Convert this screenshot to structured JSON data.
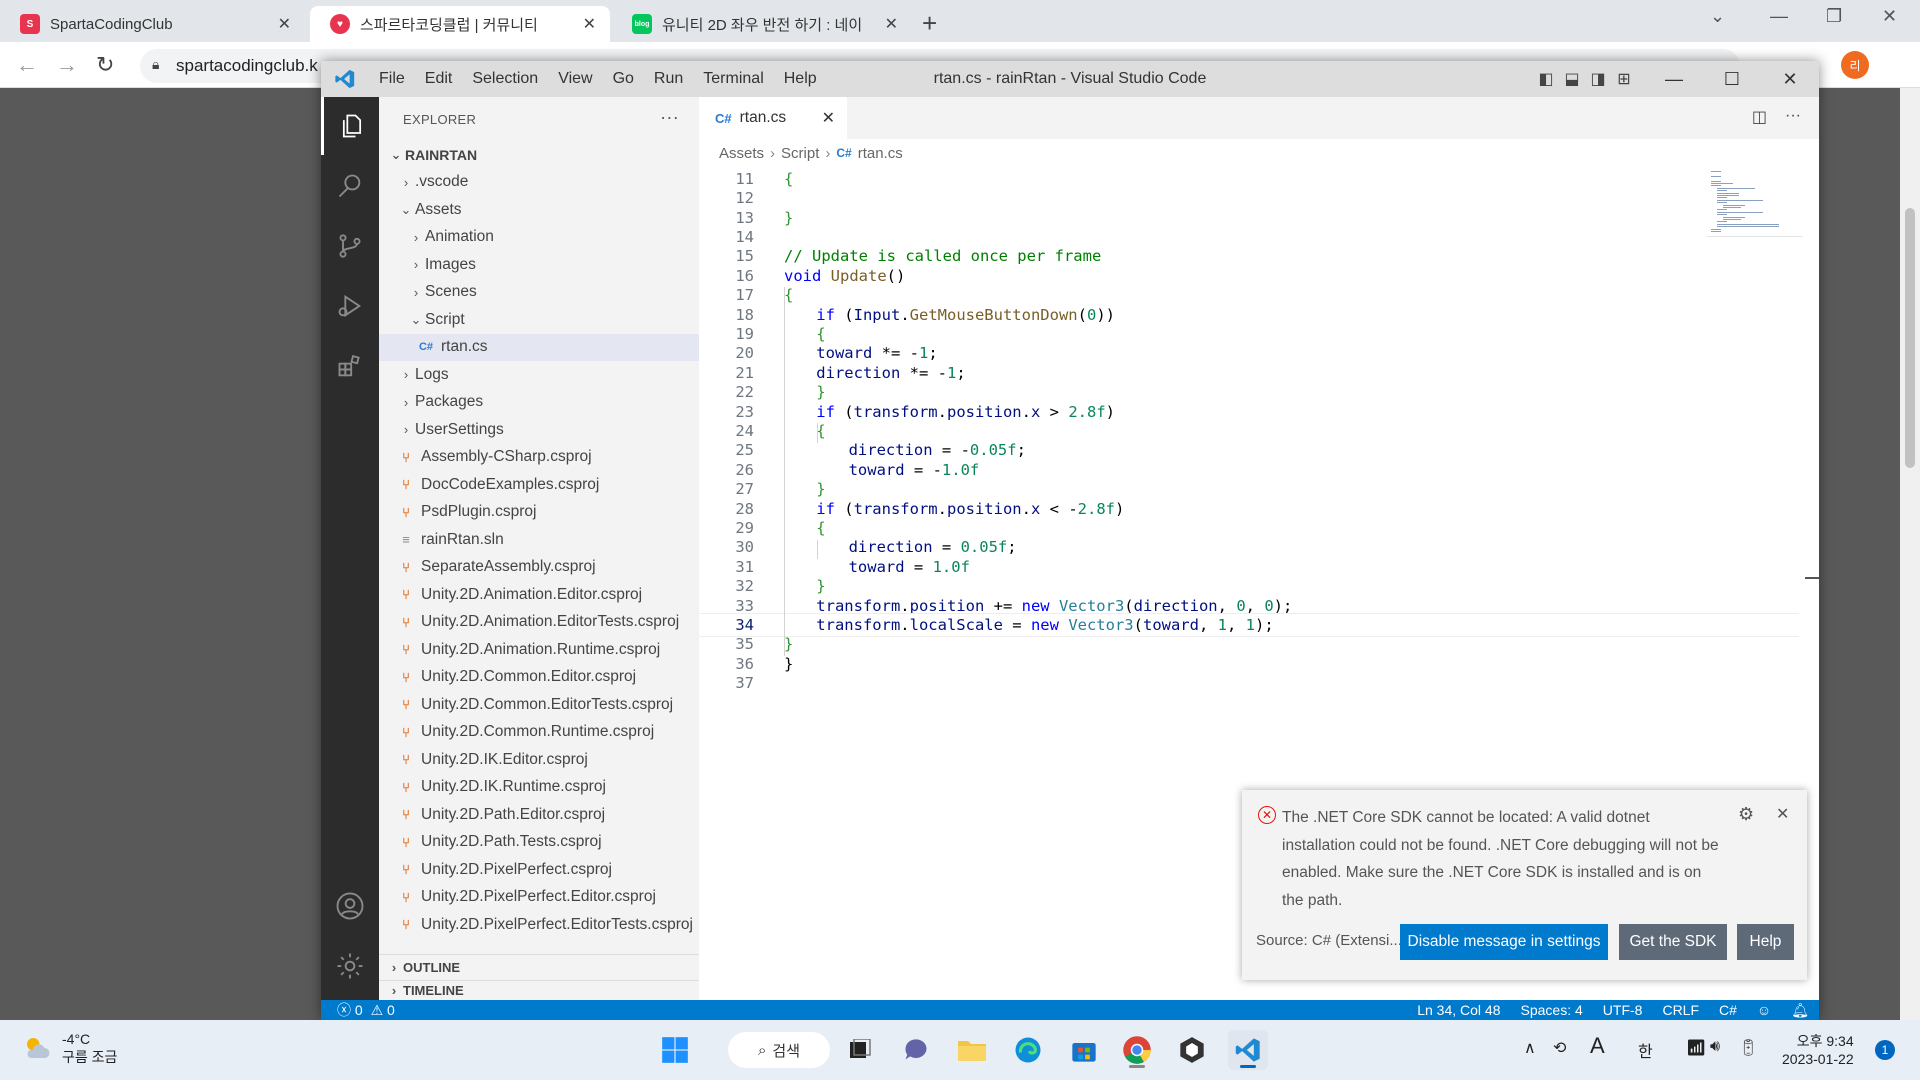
{
  "browser": {
    "tabs": [
      {
        "label": "SpartaCodingClub",
        "active": false
      },
      {
        "label": "스파르타코딩클럽 | 커뮤니티",
        "active": true
      },
      {
        "label": "유니티 2D 좌우 반전 하기 : 네이",
        "active": false
      }
    ],
    "url": "spartacodingclub.k",
    "profile_initial": "리"
  },
  "vscode": {
    "window_title": "rtan.cs - rainRtan - Visual Studio Code",
    "menu": [
      "File",
      "Edit",
      "Selection",
      "View",
      "Go",
      "Run",
      "Terminal",
      "Help"
    ],
    "explorer": {
      "header": "EXPLORER",
      "root": "RAINRTAN",
      "items": [
        {
          "label": ".vscode",
          "type": "folder",
          "depth": 1,
          "open": false
        },
        {
          "label": "Assets",
          "type": "folder",
          "depth": 1,
          "open": true
        },
        {
          "label": "Animation",
          "type": "folder",
          "depth": 2,
          "open": false
        },
        {
          "label": "Images",
          "type": "folder",
          "depth": 2,
          "open": false
        },
        {
          "label": "Scenes",
          "type": "folder",
          "depth": 2,
          "open": false
        },
        {
          "label": "Script",
          "type": "folder",
          "depth": 2,
          "open": true
        },
        {
          "label": "rtan.cs",
          "type": "cs",
          "depth": 3,
          "selected": true
        },
        {
          "label": "Logs",
          "type": "folder",
          "depth": 1,
          "open": false
        },
        {
          "label": "Packages",
          "type": "folder",
          "depth": 1,
          "open": false
        },
        {
          "label": "UserSettings",
          "type": "folder",
          "depth": 1,
          "open": false
        },
        {
          "label": "Assembly-CSharp.csproj",
          "type": "csproj",
          "depth": 1
        },
        {
          "label": "DocCodeExamples.csproj",
          "type": "csproj",
          "depth": 1
        },
        {
          "label": "PsdPlugin.csproj",
          "type": "csproj",
          "depth": 1
        },
        {
          "label": "rainRtan.sln",
          "type": "sln",
          "depth": 1
        },
        {
          "label": "SeparateAssembly.csproj",
          "type": "csproj",
          "depth": 1
        },
        {
          "label": "Unity.2D.Animation.Editor.csproj",
          "type": "csproj",
          "depth": 1
        },
        {
          "label": "Unity.2D.Animation.EditorTests.csproj",
          "type": "csproj",
          "depth": 1
        },
        {
          "label": "Unity.2D.Animation.Runtime.csproj",
          "type": "csproj",
          "depth": 1
        },
        {
          "label": "Unity.2D.Common.Editor.csproj",
          "type": "csproj",
          "depth": 1
        },
        {
          "label": "Unity.2D.Common.EditorTests.csproj",
          "type": "csproj",
          "depth": 1
        },
        {
          "label": "Unity.2D.Common.Runtime.csproj",
          "type": "csproj",
          "depth": 1
        },
        {
          "label": "Unity.2D.IK.Editor.csproj",
          "type": "csproj",
          "depth": 1
        },
        {
          "label": "Unity.2D.IK.Runtime.csproj",
          "type": "csproj",
          "depth": 1
        },
        {
          "label": "Unity.2D.Path.Editor.csproj",
          "type": "csproj",
          "depth": 1
        },
        {
          "label": "Unity.2D.Path.Tests.csproj",
          "type": "csproj",
          "depth": 1
        },
        {
          "label": "Unity.2D.PixelPerfect.csproj",
          "type": "csproj",
          "depth": 1
        },
        {
          "label": "Unity.2D.PixelPerfect.Editor.csproj",
          "type": "csproj",
          "depth": 1
        },
        {
          "label": "Unity.2D.PixelPerfect.EditorTests.csproj",
          "type": "csproj",
          "depth": 1
        }
      ],
      "outline": "OUTLINE",
      "timeline": "TIMELINE"
    },
    "editor_tab": "rtan.cs",
    "breadcrumb": [
      "Assets",
      "Script",
      "rtan.cs"
    ],
    "code_lines": [
      {
        "n": "11",
        "indent": 0,
        "t": [
          [
            "br",
            "{"
          ]
        ]
      },
      {
        "n": "12",
        "indent": 0,
        "t": []
      },
      {
        "n": "13",
        "indent": 0,
        "t": [
          [
            "br",
            "}"
          ]
        ]
      },
      {
        "n": "14",
        "indent": 0,
        "t": []
      },
      {
        "n": "15",
        "indent": 0,
        "t": [
          [
            "com",
            "// Update is called once per frame"
          ]
        ]
      },
      {
        "n": "16",
        "indent": 0,
        "t": [
          [
            "kw",
            "void"
          ],
          [
            "p",
            " "
          ],
          [
            "fn",
            "Update"
          ],
          [
            "p",
            "()"
          ]
        ]
      },
      {
        "n": "17",
        "indent": 0,
        "t": [
          [
            "br",
            "{"
          ]
        ]
      },
      {
        "n": "18",
        "indent": 1,
        "t": [
          [
            "kw",
            "if"
          ],
          [
            "p",
            " ("
          ],
          [
            "var",
            "Input"
          ],
          [
            "p",
            "."
          ],
          [
            "fn",
            "GetMouseButtonDown"
          ],
          [
            "p",
            "("
          ],
          [
            "num",
            "0"
          ],
          [
            "p",
            "))"
          ]
        ]
      },
      {
        "n": "19",
        "indent": 1,
        "t": [
          [
            "br",
            "{"
          ]
        ]
      },
      {
        "n": "20",
        "indent": 1,
        "t": [
          [
            "var",
            "toward"
          ],
          [
            "p",
            " *= -"
          ],
          [
            "num",
            "1"
          ],
          [
            "p",
            ";"
          ]
        ]
      },
      {
        "n": "21",
        "indent": 1,
        "t": [
          [
            "var",
            "direction"
          ],
          [
            "p",
            " *= -"
          ],
          [
            "num",
            "1"
          ],
          [
            "p",
            ";"
          ]
        ]
      },
      {
        "n": "22",
        "indent": 1,
        "t": [
          [
            "br",
            "}"
          ]
        ]
      },
      {
        "n": "23",
        "indent": 1,
        "t": [
          [
            "kw",
            "if"
          ],
          [
            "p",
            " ("
          ],
          [
            "var",
            "transform"
          ],
          [
            "p",
            "."
          ],
          [
            "var",
            "position"
          ],
          [
            "p",
            "."
          ],
          [
            "var",
            "x"
          ],
          [
            "p",
            " > "
          ],
          [
            "num",
            "2.8f"
          ],
          [
            "p",
            ")"
          ]
        ]
      },
      {
        "n": "24",
        "indent": 1,
        "t": [
          [
            "br",
            "{"
          ]
        ]
      },
      {
        "n": "25",
        "indent": 2,
        "t": [
          [
            "var",
            "direction"
          ],
          [
            "p",
            " = -"
          ],
          [
            "num",
            "0.05f"
          ],
          [
            "p",
            ";"
          ]
        ]
      },
      {
        "n": "26",
        "indent": 2,
        "t": [
          [
            "var",
            "toward"
          ],
          [
            "p",
            " = -"
          ],
          [
            "num",
            "1.0f"
          ]
        ]
      },
      {
        "n": "27",
        "indent": 1,
        "t": [
          [
            "br",
            "}"
          ]
        ]
      },
      {
        "n": "28",
        "indent": 1,
        "t": [
          [
            "kw",
            "if"
          ],
          [
            "p",
            " ("
          ],
          [
            "var",
            "transform"
          ],
          [
            "p",
            "."
          ],
          [
            "var",
            "position"
          ],
          [
            "p",
            "."
          ],
          [
            "var",
            "x"
          ],
          [
            "p",
            " < -"
          ],
          [
            "num",
            "2.8f"
          ],
          [
            "p",
            ")"
          ]
        ]
      },
      {
        "n": "29",
        "indent": 1,
        "t": [
          [
            "br",
            "{"
          ]
        ]
      },
      {
        "n": "30",
        "indent": 2,
        "t": [
          [
            "var",
            "direction"
          ],
          [
            "p",
            " = "
          ],
          [
            "num",
            "0.05f"
          ],
          [
            "p",
            ";"
          ]
        ]
      },
      {
        "n": "31",
        "indent": 2,
        "t": [
          [
            "var",
            "toward"
          ],
          [
            "p",
            " = "
          ],
          [
            "num",
            "1.0f"
          ]
        ]
      },
      {
        "n": "32",
        "indent": 1,
        "t": [
          [
            "br",
            "}"
          ]
        ]
      },
      {
        "n": "33",
        "indent": 1,
        "t": [
          [
            "var",
            "transform"
          ],
          [
            "p",
            "."
          ],
          [
            "var",
            "position"
          ],
          [
            "p",
            " += "
          ],
          [
            "kw",
            "new"
          ],
          [
            "p",
            " "
          ],
          [
            "type",
            "Vector3"
          ],
          [
            "p",
            "("
          ],
          [
            "var",
            "direction"
          ],
          [
            "p",
            ", "
          ],
          [
            "num",
            "0"
          ],
          [
            "p",
            ", "
          ],
          [
            "num",
            "0"
          ],
          [
            "p",
            ");"
          ]
        ]
      },
      {
        "n": "34",
        "indent": 1,
        "current": true,
        "t": [
          [
            "var",
            "transform"
          ],
          [
            "p",
            "."
          ],
          [
            "var",
            "localScale"
          ],
          [
            "p",
            " = "
          ],
          [
            "kw",
            "new"
          ],
          [
            "p",
            " "
          ],
          [
            "type",
            "Vector3"
          ],
          [
            "p",
            "("
          ],
          [
            "var",
            "toward"
          ],
          [
            "p",
            ", "
          ],
          [
            "num",
            "1"
          ],
          [
            "p",
            ", "
          ],
          [
            "num",
            "1"
          ],
          [
            "p",
            ");"
          ]
        ]
      },
      {
        "n": "35",
        "indent": 0,
        "t": [
          [
            "br",
            "}"
          ]
        ]
      },
      {
        "n": "36",
        "indent": 0,
        "t": [
          [
            "p",
            "}"
          ]
        ]
      },
      {
        "n": "37",
        "indent": 0,
        "t": []
      }
    ],
    "notification": {
      "message": "The .NET Core SDK cannot be located: A valid dotnet installation could not be found. .NET Core debugging will not be enabled. Make sure the .NET Core SDK is installed and is on the path.",
      "source": "Source: C# (Extensi...",
      "buttons": [
        "Disable message in settings",
        "Get the SDK",
        "Help"
      ]
    },
    "status": {
      "errors": "0",
      "warnings": "0",
      "position": "Ln 34, Col 48",
      "spaces": "Spaces: 4",
      "encoding": "UTF-8",
      "eol": "CRLF",
      "language": "C#"
    }
  },
  "taskbar": {
    "temperature": "-4°C",
    "weather_text": "구름 조금",
    "search_label": "검색",
    "ime": "A",
    "lang": "한",
    "time": "오후 9:34",
    "date": "2023-01-22",
    "notif_count": "1"
  },
  "colors": {
    "accent": "#007acc",
    "error": "#e51400",
    "csproj_icon": "#e37933"
  }
}
